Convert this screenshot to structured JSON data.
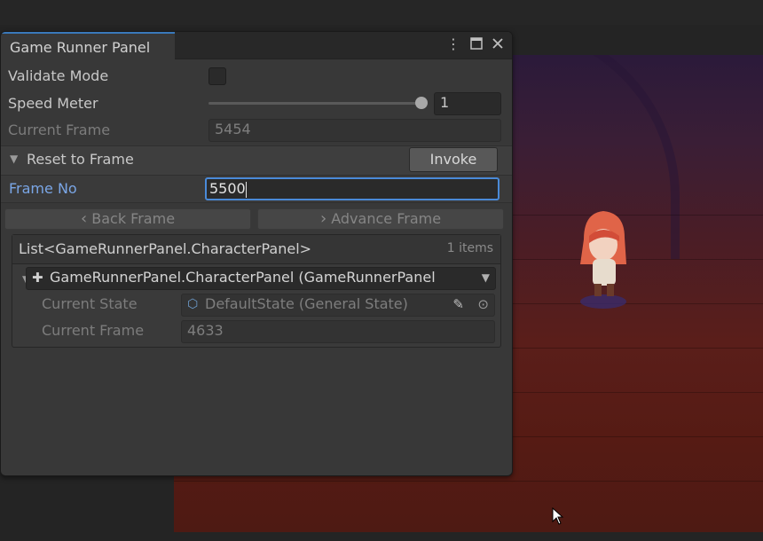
{
  "window": {
    "tab_title": "Game Runner Panel",
    "menu_icon": "kebab-menu-icon",
    "maximize_icon": "maximize-icon",
    "close_icon": "close-icon"
  },
  "fields": {
    "validate_mode": {
      "label": "Validate Mode",
      "checked": false
    },
    "speed_meter": {
      "label": "Speed Meter",
      "value": "1",
      "slider_fraction": 1.0
    },
    "current_frame": {
      "label": "Current Frame",
      "value": "5454"
    }
  },
  "reset_to_frame": {
    "label": "Reset to Frame",
    "invoke_label": "Invoke",
    "frame_no_label": "Frame No",
    "frame_no_value": "5500"
  },
  "buttons": {
    "back_frame": "Back Frame",
    "advance_frame": "Advance Frame"
  },
  "list": {
    "title": "List<GameRunnerPanel.CharacterPanel>",
    "count": "1 items",
    "element_title": "GameRunnerPanel.CharacterPanel (GameRunnerPanel",
    "current_state_label": "Current State",
    "current_state_value": "DefaultState (General State)",
    "current_frame_label": "Current Frame",
    "current_frame_value": "4633"
  },
  "colors": {
    "accent": "#3a79bb",
    "focus_border": "#4a8ad8",
    "frame_no_label": "#7aa6e6"
  }
}
